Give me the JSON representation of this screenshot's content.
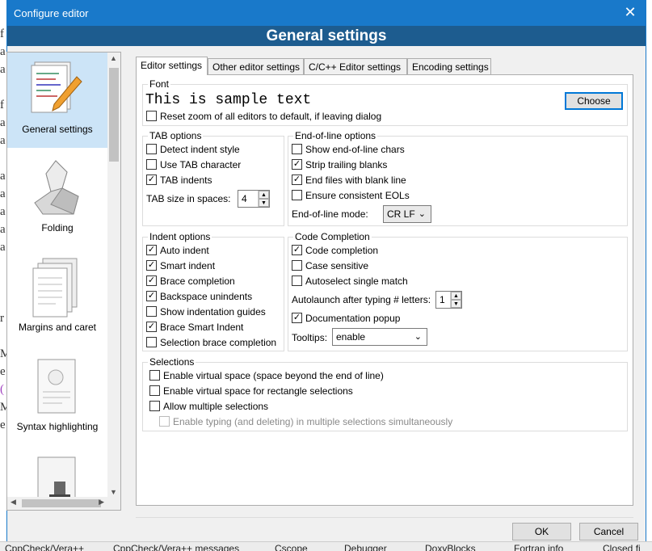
{
  "window": {
    "title": "Configure editor",
    "close_glyph": "✕"
  },
  "header": {
    "title": "General settings"
  },
  "sidebar": {
    "items": [
      {
        "label": "General settings",
        "selected": true,
        "icon": "settings-pencil-icon"
      },
      {
        "label": "Folding",
        "selected": false,
        "icon": "origami-bird-icon"
      },
      {
        "label": "Margins and caret",
        "selected": false,
        "icon": "pages-icon"
      },
      {
        "label": "Syntax highlighting",
        "selected": false,
        "icon": "highlight-page-icon"
      },
      {
        "label": "",
        "selected": false,
        "icon": "stamp-page-icon"
      }
    ]
  },
  "tabs": [
    {
      "label": "Editor settings",
      "active": true
    },
    {
      "label": "Other editor settings",
      "active": false
    },
    {
      "label": "C/C++ Editor settings",
      "active": false
    },
    {
      "label": "Encoding settings",
      "active": false
    }
  ],
  "font": {
    "group_title": "Font",
    "sample": "This is sample text",
    "choose_label": "Choose",
    "reset_zoom": {
      "label": "Reset zoom of all editors to default, if leaving dialog",
      "checked": false
    }
  },
  "tab_options": {
    "title": "TAB options",
    "items": [
      {
        "label": "Detect indent style",
        "checked": false
      },
      {
        "label": "Use TAB character",
        "checked": false
      },
      {
        "label": "TAB indents",
        "checked": true
      }
    ],
    "tab_size_label": "TAB size in spaces:",
    "tab_size_value": "4"
  },
  "eol_options": {
    "title": "End-of-line options",
    "items": [
      {
        "label": "Show end-of-line chars",
        "checked": false
      },
      {
        "label": "Strip trailing blanks",
        "checked": true
      },
      {
        "label": "End files with blank line",
        "checked": true
      },
      {
        "label": "Ensure consistent EOLs",
        "checked": false
      }
    ],
    "mode_label": "End-of-line mode:",
    "mode_value": "CR LF"
  },
  "indent_options": {
    "title": "Indent options",
    "items": [
      {
        "label": "Auto indent",
        "checked": true
      },
      {
        "label": "Smart indent",
        "checked": true
      },
      {
        "label": "Brace completion",
        "checked": true
      },
      {
        "label": "Backspace unindents",
        "checked": true
      },
      {
        "label": "Show indentation guides",
        "checked": false
      },
      {
        "label": "Brace Smart Indent",
        "checked": true
      },
      {
        "label": "Selection brace completion",
        "checked": false
      }
    ]
  },
  "code_completion": {
    "title": "Code Completion",
    "items": [
      {
        "label": "Code completion",
        "checked": true
      },
      {
        "label": "Case sensitive",
        "checked": false
      },
      {
        "label": "Autoselect single match",
        "checked": false
      }
    ],
    "autolaunch_label": "Autolaunch after typing # letters:",
    "autolaunch_value": "1",
    "doc_popup": {
      "label": "Documentation popup",
      "checked": true
    },
    "tooltips_label": "Tooltips:",
    "tooltips_value": "enable"
  },
  "selections": {
    "title": "Selections",
    "items": [
      {
        "label": "Enable virtual space (space beyond the end of line)",
        "checked": false
      },
      {
        "label": "Enable virtual space for rectangle selections",
        "checked": false
      },
      {
        "label": "Allow multiple selections",
        "checked": false
      }
    ],
    "multi_typing": {
      "label": "Enable typing (and deleting) in multiple selections simultaneously",
      "checked": false,
      "disabled": true
    }
  },
  "buttons": {
    "ok": "OK",
    "cancel": "Cancel"
  },
  "taskbar": {
    "items": [
      "CppCheck/Vera++",
      "CppCheck/Vera++ messages",
      "Cscope",
      "Debugger",
      "DoxyBlocks",
      "Fortran info",
      "Closed fi"
    ]
  },
  "background_text": [
    "f",
    "a",
    "a",
    "f",
    "a",
    "a",
    "a",
    "a",
    "a",
    "a",
    "a",
    "r",
    "M",
    "e",
    "(",
    "M",
    "e"
  ]
}
